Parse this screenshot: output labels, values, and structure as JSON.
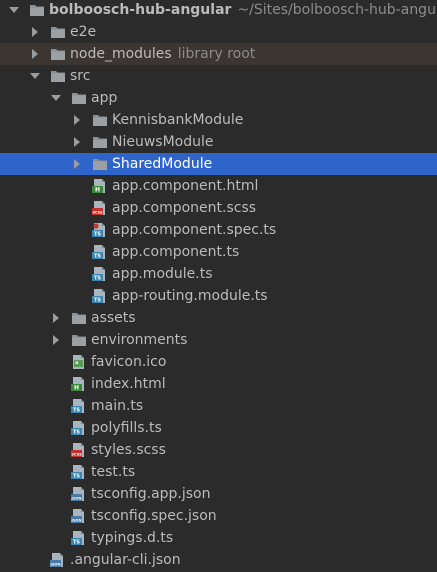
{
  "project": {
    "name": "bolboosch-hub-angular",
    "path": "~/Sites/bolboosch-hub-angular"
  },
  "rows": [
    {
      "label": "bolboosch-hub-angular",
      "hint": "~/Sites/bolboosch-hub-angular",
      "type": "project",
      "depth": 0,
      "arrow": "down",
      "icon": "folder"
    },
    {
      "label": "e2e",
      "type": "folder",
      "depth": 1,
      "arrow": "right",
      "icon": "folder"
    },
    {
      "label": "node_modules",
      "hint": "library root",
      "type": "folder",
      "depth": 1,
      "arrow": "right",
      "icon": "folder",
      "state": "excluded"
    },
    {
      "label": "src",
      "type": "folder",
      "depth": 1,
      "arrow": "down",
      "icon": "folder"
    },
    {
      "label": "app",
      "type": "folder",
      "depth": 2,
      "arrow": "down",
      "icon": "folder"
    },
    {
      "label": "KennisbankModule",
      "type": "folder",
      "depth": 3,
      "arrow": "right",
      "icon": "folder"
    },
    {
      "label": "NieuwsModule",
      "type": "folder",
      "depth": 3,
      "arrow": "right",
      "icon": "folder"
    },
    {
      "label": "SharedModule",
      "type": "folder",
      "depth": 3,
      "arrow": "right",
      "icon": "folder",
      "state": "selected"
    },
    {
      "label": "app.component.html",
      "type": "file",
      "depth": 3,
      "icon": "html"
    },
    {
      "label": "app.component.scss",
      "type": "file",
      "depth": 3,
      "icon": "scss"
    },
    {
      "label": "app.component.spec.ts",
      "type": "file",
      "depth": 3,
      "icon": "ts-spec"
    },
    {
      "label": "app.component.ts",
      "type": "file",
      "depth": 3,
      "icon": "ts"
    },
    {
      "label": "app.module.ts",
      "type": "file",
      "depth": 3,
      "icon": "ts"
    },
    {
      "label": "app-routing.module.ts",
      "type": "file",
      "depth": 3,
      "icon": "ts"
    },
    {
      "label": "assets",
      "type": "folder",
      "depth": 2,
      "arrow": "right",
      "icon": "folder"
    },
    {
      "label": "environments",
      "type": "folder",
      "depth": 2,
      "arrow": "right",
      "icon": "folder"
    },
    {
      "label": "favicon.ico",
      "type": "file",
      "depth": 2,
      "icon": "image"
    },
    {
      "label": "index.html",
      "type": "file",
      "depth": 2,
      "icon": "html"
    },
    {
      "label": "main.ts",
      "type": "file",
      "depth": 2,
      "icon": "ts"
    },
    {
      "label": "polyfills.ts",
      "type": "file",
      "depth": 2,
      "icon": "ts"
    },
    {
      "label": "styles.scss",
      "type": "file",
      "depth": 2,
      "icon": "scss"
    },
    {
      "label": "test.ts",
      "type": "file",
      "depth": 2,
      "icon": "ts"
    },
    {
      "label": "tsconfig.app.json",
      "type": "file",
      "depth": 2,
      "icon": "json"
    },
    {
      "label": "tsconfig.spec.json",
      "type": "file",
      "depth": 2,
      "icon": "json"
    },
    {
      "label": "typings.d.ts",
      "type": "file",
      "depth": 2,
      "icon": "ts"
    },
    {
      "label": ".angular-cli.json",
      "type": "file",
      "depth": 1,
      "icon": "json"
    }
  ],
  "icon_labels": {
    "html": "H",
    "scss": "SCSS",
    "ts": "TS",
    "json": "JSON"
  },
  "colors": {
    "background": "#2b2b2b",
    "selection": "#2f65ca",
    "excluded_row": "#3b3632",
    "folder": "#8a8f93",
    "html_badge": "#3a8a3a",
    "scss_badge": "#c2332f",
    "ts_badge": "#3b86b2",
    "json_badge": "#4a7aa8"
  }
}
